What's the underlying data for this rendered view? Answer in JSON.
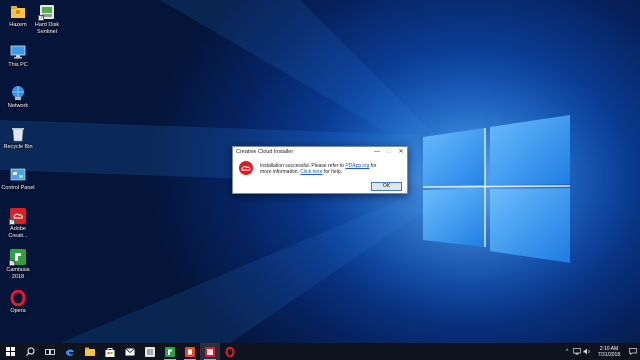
{
  "desktop": {
    "icons": [
      {
        "label": "Hazem"
      },
      {
        "label": "Hard Disk Sentinel"
      },
      {
        "label": "This PC"
      },
      {
        "label": "Network"
      },
      {
        "label": "Recycle Bin"
      },
      {
        "label": "Control Panel"
      },
      {
        "label": "Adobe Creati..."
      },
      {
        "label": "Camtasia 2018"
      },
      {
        "label": "Opera"
      }
    ]
  },
  "dialog": {
    "title": "Creative Cloud Installer",
    "message_part1": "Installation successful. Please refer to ",
    "log_link": "PDApp.log",
    "message_part2": " for more information. ",
    "help_link": "Click here",
    "message_part3": " for help.",
    "ok_label": "OK",
    "minimize_glyph": "—",
    "maximize_glyph": "☐",
    "close_glyph": "✕"
  },
  "taskbar": {
    "items": [
      "start-icon",
      "search-icon",
      "task-view-icon",
      "edge-icon",
      "file-explorer-icon",
      "store-icon",
      "mail-icon",
      "media-icon",
      "camtasia-icon",
      "office-icon",
      "creative-cloud-icon",
      "opera-icon"
    ],
    "tray": {
      "chevron": "^",
      "time": "2:10 AM",
      "date": "7/31/2018"
    }
  },
  "colors": {
    "accent": "#1a73d8",
    "adobe_red": "#da1f26",
    "taskbar": "#0d1420"
  }
}
